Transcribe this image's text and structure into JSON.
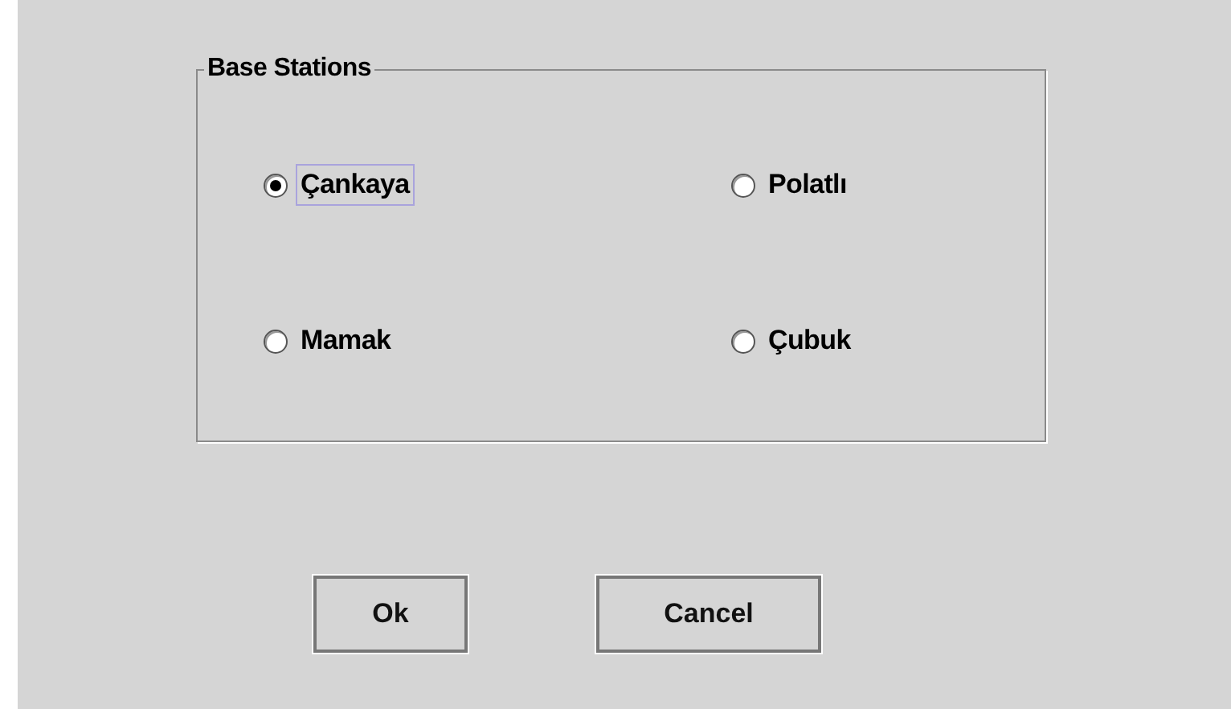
{
  "group": {
    "title": "Base Stations",
    "options": [
      {
        "label": "Çankaya",
        "selected": true,
        "focused": true
      },
      {
        "label": "Polatlı",
        "selected": false,
        "focused": false
      },
      {
        "label": "Mamak",
        "selected": false,
        "focused": false
      },
      {
        "label": "Çubuk",
        "selected": false,
        "focused": false
      }
    ]
  },
  "buttons": [
    "Ok",
    "Cancel"
  ]
}
